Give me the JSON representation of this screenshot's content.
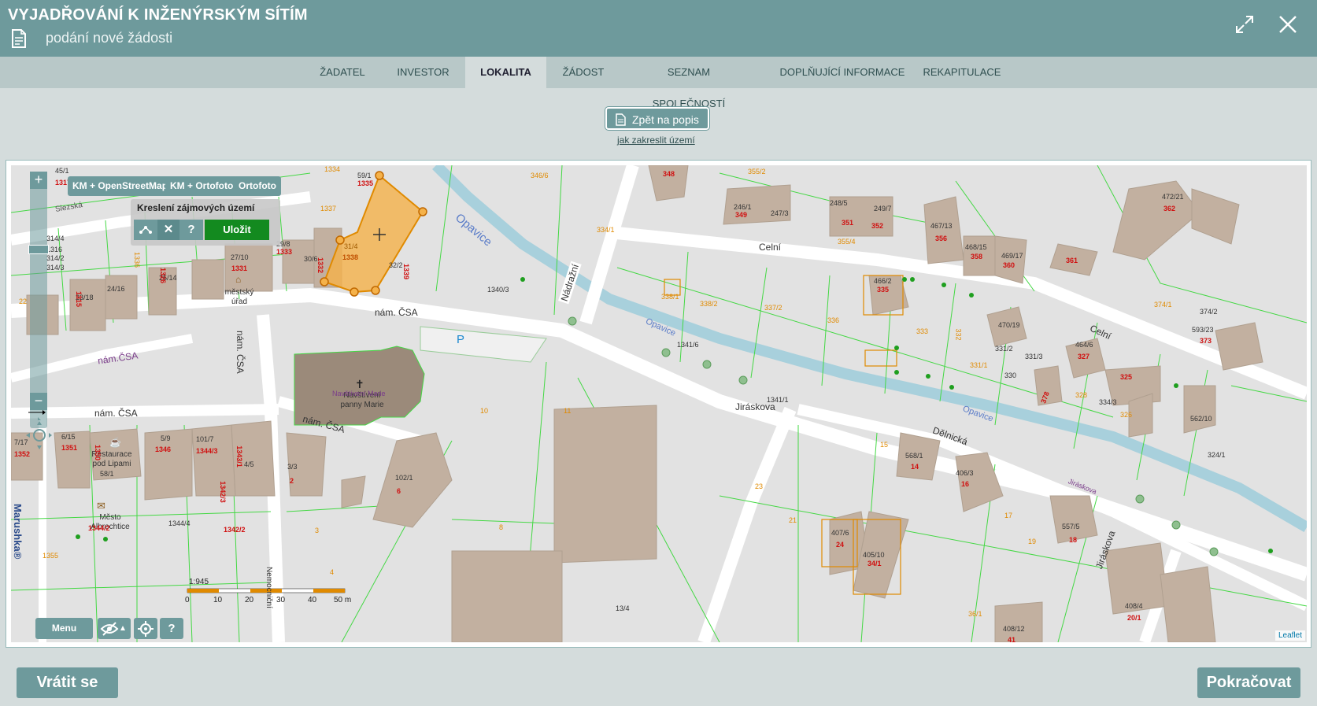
{
  "header": {
    "title": "VYJADŘOVÁNÍ K INŽENÝRSKÝM SÍTÍM",
    "subtitle": "podání nové žádosti"
  },
  "tabs": [
    {
      "label": "ŽADATEL",
      "active": false
    },
    {
      "label": "INVESTOR",
      "active": false
    },
    {
      "label": "LOKALITA",
      "active": true
    },
    {
      "label": "ŽÁDOST",
      "active": false
    },
    {
      "label": "SEZNAM SPOLEČNOSTÍ",
      "active": false
    },
    {
      "label": "DOPLŇUJÍCÍ INFORMACE",
      "active": false
    },
    {
      "label": "REKAPITULACE",
      "active": false
    }
  ],
  "back_to_description": "Zpět na popis",
  "howto_link": "jak zakreslit území",
  "map": {
    "layers": [
      "KM + OpenStreetMap",
      "KM + Ortofoto",
      "Ortofoto"
    ],
    "zoom_in": "+",
    "zoom_out": "−",
    "draw_panel": {
      "title": "Kreslení zájmových území",
      "cancel": "✕",
      "help": "?",
      "save": "Uložit"
    },
    "menu": "Menu",
    "help": "?",
    "scale": {
      "ratio": "1:945",
      "ticks": [
        "0",
        "10",
        "20",
        "30",
        "40",
        "50 m"
      ]
    },
    "attribution": "Leaflet",
    "brand": "Marushka®",
    "streets": {
      "celni_1": "Celní",
      "celni_2": "Celní",
      "nadrazni": "Nádražní",
      "nam_csa_1": "nám. ČSA",
      "nam_csa_2": "nám. ČSA",
      "nam_csa_3": "nám.ČSA",
      "nam_csa_4": "nám. ČSA",
      "nam_csa_5": "nám. ČSA",
      "jiraskova_1": "Jiráskova",
      "jiraskova_2": "Jiráskova",
      "jiraskova_3": "Jiráskova",
      "delnicka": "Dělnická",
      "slezska": "Slezská",
      "nemocnicni": "Nemocniční"
    },
    "rivers": {
      "opavice_1": "Opavice",
      "opavice_2": "Opavice",
      "opavice_3": "Opavice"
    },
    "parking": "P",
    "pois": {
      "church": "Navštívení panny Marie",
      "church_overlay": "Navštívení Marie",
      "town_hall": "městský úřad",
      "restaurant": "Restaurace pod Lipami",
      "town": "Město Albrechtice"
    },
    "parcels": {
      "p1": "45/1",
      "p2": "1317",
      "p3": "59/1",
      "p4": "1335",
      "p5": "1334",
      "p6": "1337",
      "p7": "1336",
      "p8": "314/4",
      "p9": "1316",
      "p10": "314/2",
      "p11": "314/3",
      "p12": "29/8",
      "p13": "1333",
      "p14": "27/10",
      "p15": "1331",
      "p16": "30/6",
      "p17": "1332",
      "p18": "31/4",
      "p19": "1338",
      "p20": "32/2",
      "p21": "1339",
      "p22": "1340/3",
      "p23": "23/18",
      "p24": "1315",
      "p25": "24/16",
      "p26": "25/14",
      "p27": "1326",
      "p28": "346/6",
      "p29": "348",
      "p30": "355/2",
      "p31": "246/1",
      "p32": "349",
      "p33": "247/3",
      "p34": "248/5",
      "p35": "351",
      "p36": "249/7",
      "p37": "352",
      "p38": "355/4",
      "p39": "334/1",
      "p40": "467/13",
      "p41": "356",
      "p42": "468/15",
      "p43": "358",
      "p44": "469/17",
      "p45": "360",
      "p46": "361",
      "p47": "472/21",
      "p48": "362",
      "p49": "338/1",
      "p50": "338/2",
      "p51": "337/2",
      "p52": "336",
      "p53": "466/2",
      "p54": "335",
      "p55": "333",
      "p56": "332",
      "p57": "470/19",
      "p58": "331/2",
      "p59": "331/3",
      "p60": "331/1",
      "p61": "330",
      "p62": "464/6",
      "p63": "327",
      "p64": "325",
      "p65": "326",
      "p66": "328",
      "p67": "334/3",
      "p68": "374/1",
      "p69": "374/2",
      "p70": "593/23",
      "p71": "373",
      "p72": "562/10",
      "p73": "324/1",
      "p74": "1341/6",
      "p75": "10",
      "p76": "11",
      "p77": "1341/1",
      "p78": "7/17",
      "p79": "1352",
      "p80": "6/15",
      "p81": "1351",
      "p82": "1350",
      "p83": "5/9",
      "p84": "1346",
      "p85": "101/7",
      "p86": "1344/3",
      "p87": "1343/1",
      "p88": "4/5",
      "p89": "58/1",
      "p90": "1344/4",
      "p91": "1342/3",
      "p92": "1342/2",
      "p93": "1344/2",
      "p94": "1355",
      "p95": "3/3",
      "p96": "2",
      "p97": "3",
      "p98": "4",
      "p99": "102/1",
      "p100": "6",
      "p101": "8",
      "p102": "13/4",
      "p103": "15",
      "p104": "568/1",
      "p105": "14",
      "p106": "406/3",
      "p107": "16",
      "p108": "17",
      "p109": "557/5",
      "p110": "18",
      "p111": "19",
      "p112": "23",
      "p113": "21",
      "p114": "407/6",
      "p115": "24",
      "p116": "405/10",
      "p117": "34/1",
      "p118": "36/1",
      "p119": "408/4",
      "p120": "20/1",
      "p121": "408/12",
      "p122": "41",
      "p123": "378",
      "p124": "22"
    }
  },
  "bottom": {
    "back": "Vrátit se",
    "continue": "Pokračovat"
  },
  "colors": {
    "accent": "#6e9a9c",
    "save_green": "#138a1f",
    "selection_fill": "#f5b24a",
    "parcel_line": "#44d844",
    "building_fill": "#c2b0a0",
    "river": "#a8d0dc"
  }
}
